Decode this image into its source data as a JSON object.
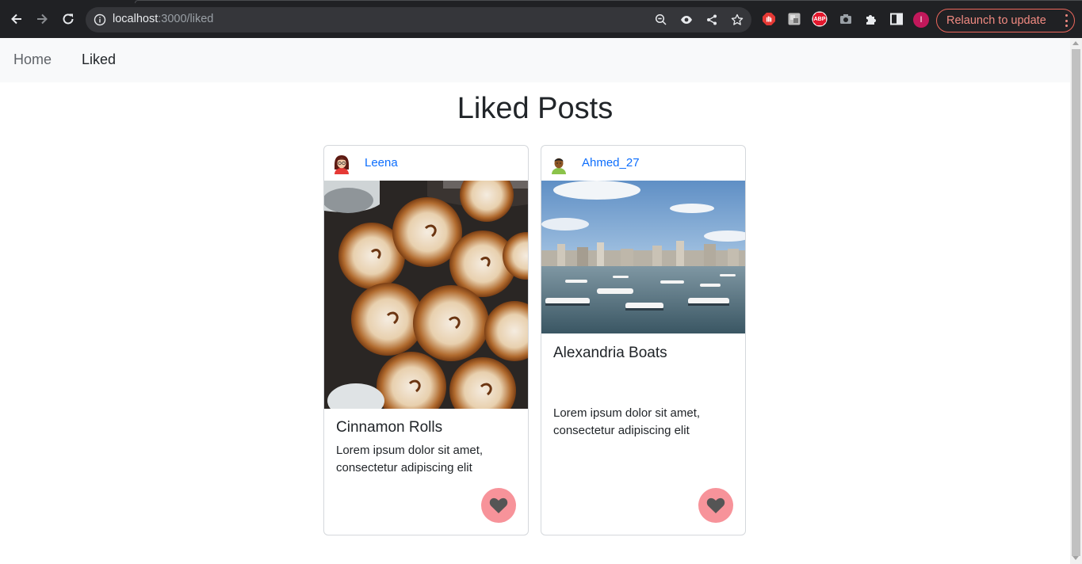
{
  "browser": {
    "url_host": "localhost",
    "url_path": ":3000/liked",
    "relaunch_label": "Relaunch to update",
    "profile_initial": "I",
    "extension_abp": "ABP"
  },
  "navbar": {
    "items": [
      {
        "label": "Home"
      },
      {
        "label": "Liked"
      }
    ]
  },
  "page": {
    "title": "Liked Posts"
  },
  "posts": [
    {
      "username": "Leena",
      "title": "Cinnamon Rolls",
      "body": "Lorem ipsum dolor sit amet, consectetur adipiscing elit",
      "liked": true
    },
    {
      "username": "Ahmed_27",
      "title": "Alexandria Boats",
      "body": "Lorem ipsum dolor sit amet, consectetur adipiscing elit",
      "liked": true
    }
  ],
  "colors": {
    "accent_link": "#0d6efd",
    "like_button": "#f7939a",
    "like_heart": "#555555",
    "relaunch": "#f28b82"
  }
}
